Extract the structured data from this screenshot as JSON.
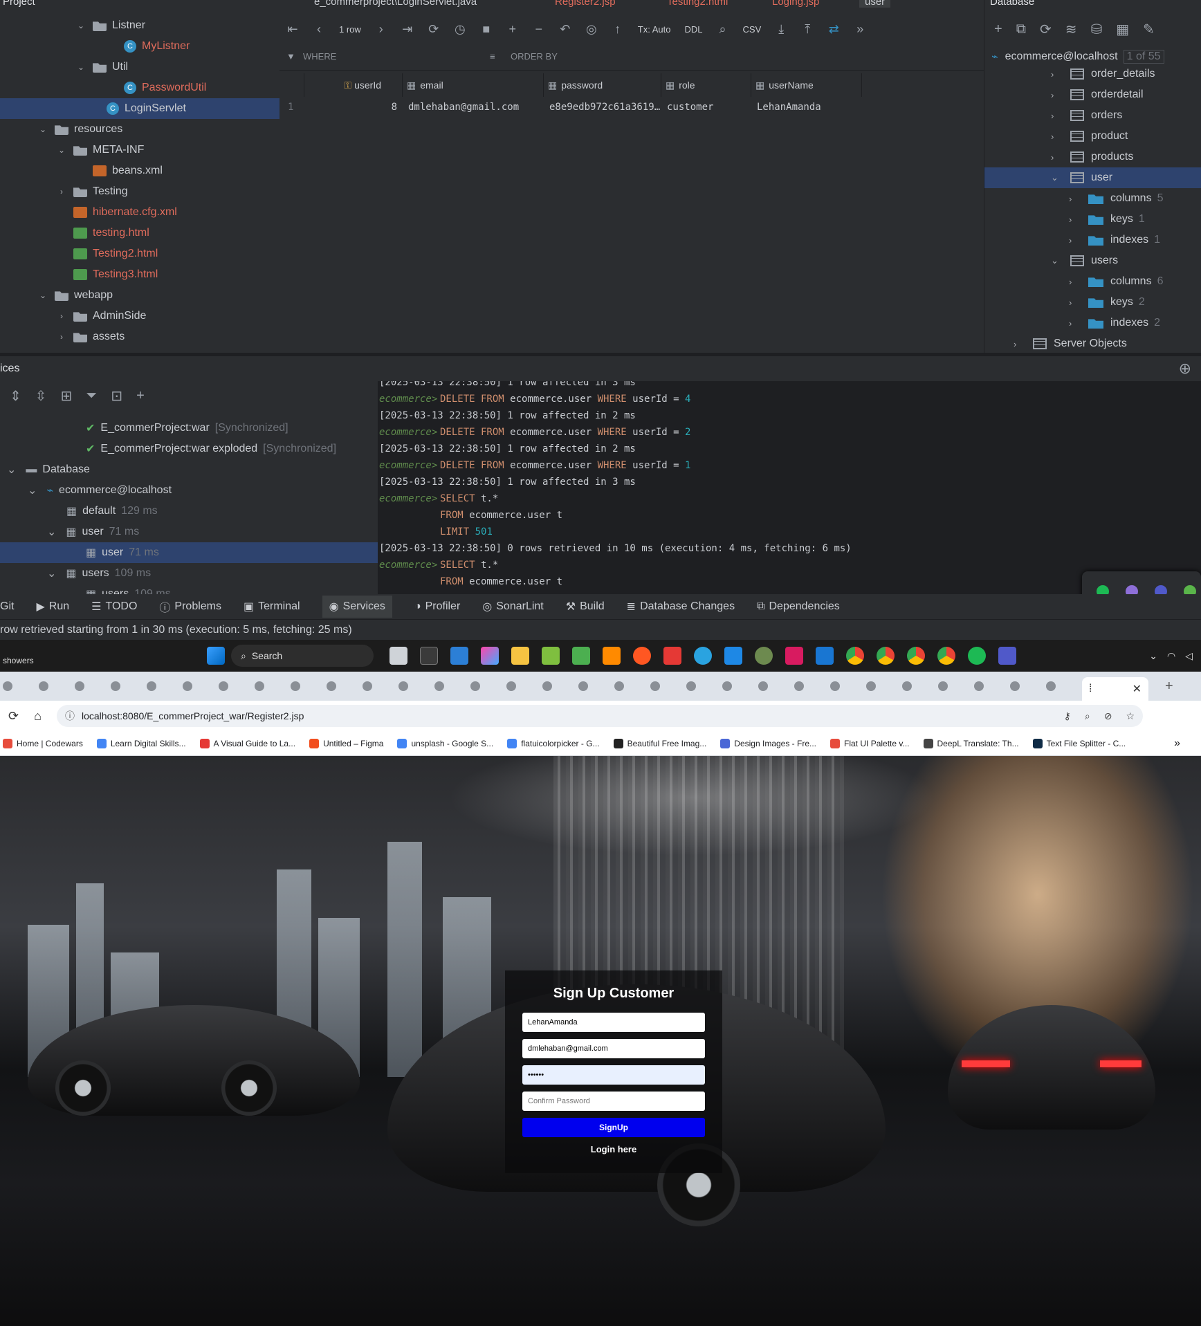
{
  "project": {
    "header": "Project",
    "tree": [
      {
        "label": "Listner",
        "kind": "folder"
      },
      {
        "label": "MyListner",
        "kind": "class"
      },
      {
        "label": "Util",
        "kind": "folder"
      },
      {
        "label": "PasswordUtil",
        "kind": "class"
      },
      {
        "label": "LoginServlet",
        "kind": "class"
      },
      {
        "label": "resources",
        "kind": "folder"
      },
      {
        "label": "META-INF",
        "kind": "folder"
      },
      {
        "label": "beans.xml",
        "kind": "file"
      },
      {
        "label": "Testing",
        "kind": "folder"
      },
      {
        "label": "hibernate.cfg.xml",
        "kind": "file"
      },
      {
        "label": "testing.html",
        "kind": "html"
      },
      {
        "label": "Testing2.html",
        "kind": "html"
      },
      {
        "label": "Testing3.html",
        "kind": "html"
      },
      {
        "label": "webapp",
        "kind": "folder"
      },
      {
        "label": "AdminSide",
        "kind": "folder"
      },
      {
        "label": "assets",
        "kind": "folder"
      }
    ]
  },
  "editor_tabs": [
    "e_commerproject\\LoginServlet.java",
    "Register2.jsp",
    "Testing2.html",
    "Loging.jsp",
    "user"
  ],
  "grid_toolbar": {
    "rows": "1 row",
    "tx": "Tx: Auto",
    "ddl": "DDL",
    "format": "CSV"
  },
  "filter": {
    "where": "WHERE",
    "order_by": "ORDER BY"
  },
  "grid": {
    "columns": [
      "userId",
      "email",
      "password",
      "role",
      "userName"
    ],
    "rows": [
      {
        "num": "1",
        "cells": [
          "8",
          "dmlehaban@gmail.com",
          "e8e9edb972c61a3619…",
          "customer",
          "LehanAmanda"
        ]
      }
    ]
  },
  "database": {
    "header": "Database",
    "connection": "ecommerce@localhost",
    "connection_count": "1 of 55",
    "items": [
      {
        "label": "order_details",
        "count": ""
      },
      {
        "label": "orderdetail",
        "count": ""
      },
      {
        "label": "orders",
        "count": ""
      },
      {
        "label": "product",
        "count": ""
      },
      {
        "label": "products",
        "count": ""
      },
      {
        "label": "user",
        "count": ""
      },
      {
        "label": "columns",
        "count": "5"
      },
      {
        "label": "keys",
        "count": "1"
      },
      {
        "label": "indexes",
        "count": "1"
      },
      {
        "label": "users",
        "count": ""
      },
      {
        "label": "columns",
        "count": "6"
      },
      {
        "label": "keys",
        "count": "2"
      },
      {
        "label": "indexes",
        "count": "2"
      },
      {
        "label": "Server Objects",
        "count": ""
      }
    ]
  },
  "services": {
    "header": "ices",
    "tree": [
      {
        "label": "E_commerProject:war",
        "meta": "[Synchronized]"
      },
      {
        "label": "E_commerProject:war exploded",
        "meta": "[Synchronized]"
      },
      {
        "label": "Database",
        "meta": ""
      },
      {
        "label": "ecommerce@localhost",
        "meta": ""
      },
      {
        "label": "default",
        "meta": "129 ms"
      },
      {
        "label": "user",
        "meta": "71 ms"
      },
      {
        "label": "user",
        "meta": "71 ms"
      },
      {
        "label": "users",
        "meta": "109 ms"
      },
      {
        "label": "users",
        "meta": "109 ms"
      }
    ]
  },
  "console": {
    "lines": [
      {
        "type": "log",
        "text": "[2025-03-13 22:38:50] 1 row affected in 3 ms"
      },
      {
        "type": "sql",
        "prompt": "ecommerce>",
        "kw": "DELETE FROM",
        "mid": " ecommerce.user ",
        "kw2": "WHERE",
        "rest": " userId = ",
        "num": "4"
      },
      {
        "type": "log",
        "text": "[2025-03-13 22:38:50] 1 row affected in 2 ms"
      },
      {
        "type": "sql",
        "prompt": "ecommerce>",
        "kw": "DELETE FROM",
        "mid": " ecommerce.user ",
        "kw2": "WHERE",
        "rest": " userId = ",
        "num": "2"
      },
      {
        "type": "log",
        "text": "[2025-03-13 22:38:50] 1 row affected in 2 ms"
      },
      {
        "type": "sql",
        "prompt": "ecommerce>",
        "kw": "DELETE FROM",
        "mid": " ecommerce.user ",
        "kw2": "WHERE",
        "rest": " userId = ",
        "num": "1"
      },
      {
        "type": "log",
        "text": "[2025-03-13 22:38:50] 1 row affected in 3 ms"
      },
      {
        "type": "sql",
        "prompt": "ecommerce>",
        "kw": "SELECT",
        "mid": " t.*",
        "kw2": "",
        "rest": "",
        "num": ""
      },
      {
        "type": "sql",
        "prompt": "",
        "kw": "FROM",
        "mid": " ecommerce.user t",
        "kw2": "",
        "rest": "",
        "num": ""
      },
      {
        "type": "sql",
        "prompt": "",
        "kw": "LIMIT",
        "mid": " ",
        "kw2": "",
        "rest": "",
        "num": "501"
      },
      {
        "type": "log",
        "text": "[2025-03-13 22:38:50] 0 rows retrieved in 10 ms (execution: 4 ms, fetching: 6 ms)"
      },
      {
        "type": "sql",
        "prompt": "ecommerce>",
        "kw": "SELECT",
        "mid": " t.*",
        "kw2": "",
        "rest": "",
        "num": ""
      },
      {
        "type": "sql",
        "prompt": "",
        "kw": "FROM",
        "mid": " ecommerce.user t",
        "kw2": "",
        "rest": "",
        "num": ""
      }
    ]
  },
  "bottom_tabs": [
    "Git",
    "Run",
    "TODO",
    "Problems",
    "Terminal",
    "Services",
    "Profiler",
    "SonarLint",
    "Build",
    "Database Changes",
    "Dependencies"
  ],
  "status": "row retrieved starting from 1 in 30 ms (execution: 5 ms, fetching: 25 ms)",
  "taskbar": {
    "weather": "showers",
    "search": "Search"
  },
  "browser": {
    "url": "localhost:8080/E_commerProject_war/Register2.jsp",
    "bookmarks": [
      "Home | Codewars",
      "Learn Digital Skills...",
      "A Visual Guide to La...",
      "Untitled – Figma",
      "unsplash - Google S...",
      "flatuicolorpicker - G...",
      "Beautiful Free Imag...",
      "Design Images - Fre...",
      "Flat UI Palette v...",
      "DeepL Translate: Th...",
      "Text File Splitter - C..."
    ]
  },
  "signup": {
    "title": "Sign Up Customer",
    "username": "LehanAmanda",
    "email": "dmlehaban@gmail.com",
    "password_mask": "••••••",
    "confirm_placeholder": "Confirm Password",
    "button": "SignUp",
    "login_link": "Login here"
  },
  "colors": {
    "accent": "#0000ee",
    "selection": "#2e436e",
    "keyword": "#cf8e6d"
  }
}
